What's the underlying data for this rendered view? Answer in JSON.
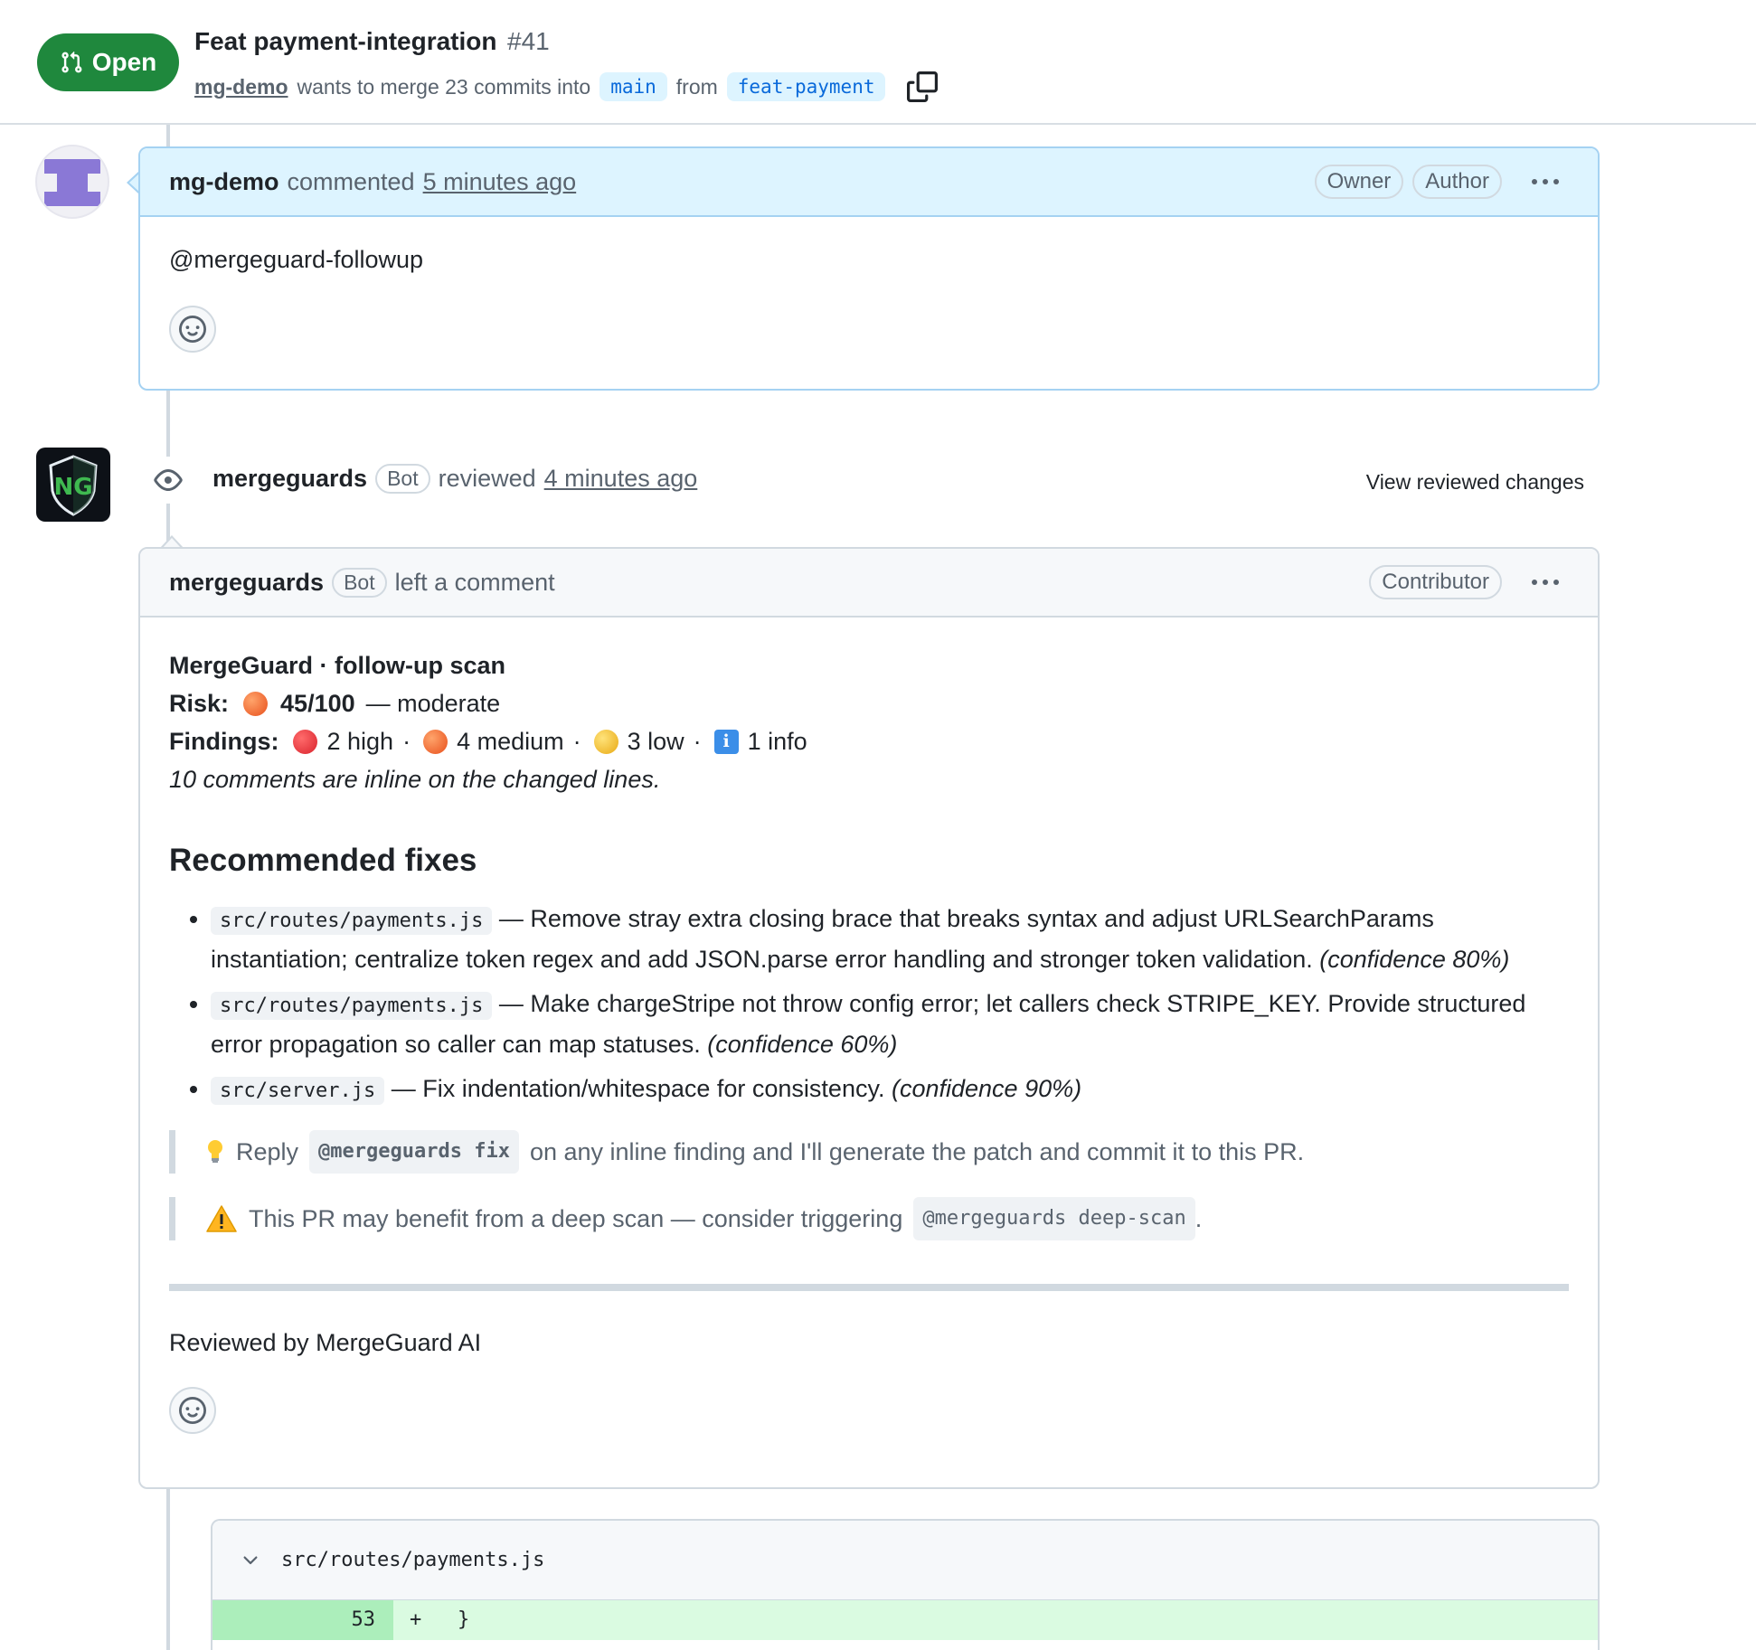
{
  "pr": {
    "state": "Open",
    "title": "Feat payment-integration",
    "number": "#41",
    "author": "mg-demo",
    "merge_text": "wants to merge 23 commits into",
    "base_branch": "main",
    "from_text": "from",
    "head_branch": "feat-payment"
  },
  "comment1": {
    "author": "mg-demo",
    "action": "commented",
    "time": "5 minutes ago",
    "labels": [
      "Owner",
      "Author"
    ],
    "body": "@mergeguard-followup"
  },
  "review": {
    "author": "mergeguards",
    "bot_label": "Bot",
    "action": "reviewed",
    "time": "4 minutes ago",
    "view_changes": "View reviewed changes"
  },
  "comment2": {
    "author": "mergeguards",
    "bot_label": "Bot",
    "action": "left a comment",
    "role_label": "Contributor",
    "summary": {
      "title": "MergeGuard · follow-up scan",
      "risk_label": "Risk:",
      "risk_score": "45/100",
      "risk_text": "— moderate",
      "findings_label": "Findings:",
      "high": "2 high",
      "medium": "4 medium",
      "low": "3 low",
      "info": "1 info",
      "sep": "·",
      "inline_note": "10 comments are inline on the changed lines."
    },
    "fixes_heading": "Recommended fixes",
    "fixes": [
      {
        "file": "src/routes/payments.js",
        "text": "— Remove stray extra closing brace that breaks syntax and adjust URLSearchParams instantiation; centralize token regex and add JSON.parse error handling and stronger token validation.",
        "confidence": "(confidence 80%)"
      },
      {
        "file": "src/routes/payments.js",
        "text": "— Make chargeStripe not throw config error; let callers check STRIPE_KEY. Provide structured error propagation so caller can map statuses.",
        "confidence": "(confidence 60%)"
      },
      {
        "file": "src/server.js",
        "text": "— Fix indentation/whitespace for consistency.",
        "confidence": "(confidence 90%)"
      }
    ],
    "tip": {
      "prefix": "Reply",
      "code": "@mergeguards fix",
      "suffix": "on any inline finding and I'll generate the patch and commit it to this PR."
    },
    "warning": {
      "prefix": "This PR may benefit from a deep scan — consider triggering",
      "code": "@mergeguards deep-scan",
      "suffix": "."
    },
    "footer": "Reviewed by MergeGuard AI"
  },
  "diff": {
    "file": "src/routes/payments.js",
    "lines": [
      {
        "number": "53",
        "code": "+   }"
      }
    ]
  },
  "colors": {
    "open_green": "#1f883d",
    "accent_blue": "#0969da",
    "highlight_bg": "#ddf4ff",
    "diff_add_bg": "#dafbe1"
  },
  "icons": {
    "state": "git-pull-request-icon",
    "copy": "copy-icon",
    "eye": "eye-icon",
    "smiley": "smiley-icon",
    "kebab": "kebab-horizontal-icon",
    "chevron": "chevron-down-icon",
    "bulb": "light-bulb-icon",
    "warning": "warning-icon"
  }
}
